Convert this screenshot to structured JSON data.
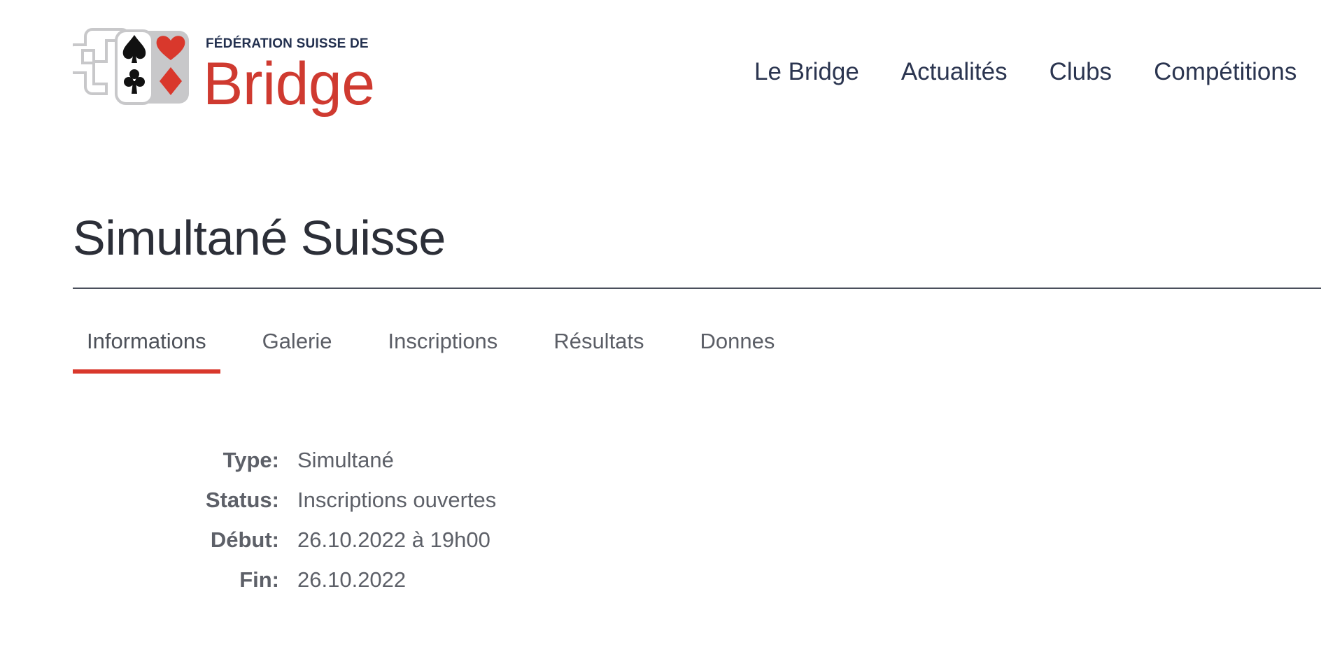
{
  "brand": {
    "subtitle": "FÉDÉRATION SUISSE DE",
    "title": "Bridge",
    "logo_icon": "fsb-card-suits-logo",
    "colors": {
      "red": "#cf3a30",
      "navy": "#23304f",
      "gray": "#c8c8ca"
    }
  },
  "nav": {
    "items": [
      "Le Bridge",
      "Actualités",
      "Clubs",
      "Compétitions"
    ]
  },
  "page": {
    "title": "Simultané Suisse"
  },
  "tabs": {
    "active": "Informations",
    "items": [
      "Informations",
      "Galerie",
      "Inscriptions",
      "Résultats",
      "Donnes"
    ]
  },
  "info": {
    "rows": [
      {
        "label": "Type:",
        "value": "Simultané"
      },
      {
        "label": "Status:",
        "value": "Inscriptions ouvertes"
      },
      {
        "label": "Début:",
        "value": "26.10.2022 à 19h00"
      },
      {
        "label": "Fin:",
        "value": "26.10.2022"
      }
    ]
  },
  "accent_color": "#d9382c"
}
